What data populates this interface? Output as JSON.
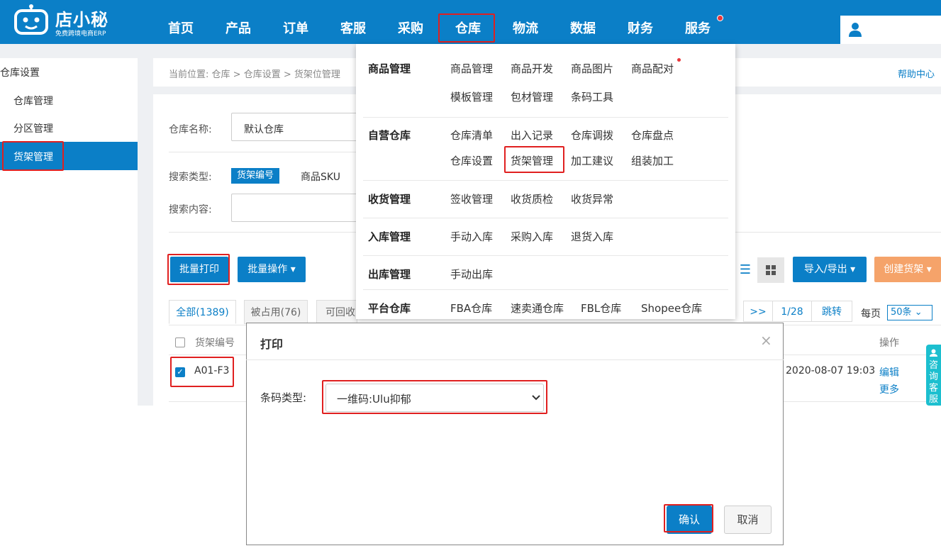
{
  "brand": {
    "name": "店小秘",
    "tagline": "免费跨境电商ERP"
  },
  "nav": {
    "items": [
      "首页",
      "产品",
      "订单",
      "客服",
      "采购",
      "仓库",
      "物流",
      "数据",
      "财务",
      "服务"
    ],
    "active": "仓库"
  },
  "sidebar": {
    "title": "仓库设置",
    "items": [
      "仓库管理",
      "分区管理",
      "货架管理"
    ],
    "active": "货架管理"
  },
  "breadcrumb": {
    "prefix": "当前位置:",
    "path": "仓库 > 仓库设置 > 货架位管理"
  },
  "help_label": "帮助中心",
  "filters": {
    "warehouse_label": "仓库名称:",
    "warehouse_value": "默认仓库",
    "search_type_label": "搜索类型:",
    "search_type_active": "货架编号",
    "search_type_other": "商品SKU",
    "search_content_label": "搜索内容:"
  },
  "actions": {
    "batch_print": "批量打印",
    "batch_ops": "批量操作",
    "import_export": "导入/导出",
    "create_shelf": "创建货架"
  },
  "tabs": [
    {
      "label": "全部(1389)"
    },
    {
      "label": "被占用(76)"
    },
    {
      "label": "可回收"
    }
  ],
  "pager": {
    "next": ">>",
    "page": "1/28",
    "jump": "跳转",
    "per_page_label": "每页",
    "per_page_value": "50条"
  },
  "table": {
    "col_code": "货架编号",
    "col_ops": "操作",
    "row": {
      "code": "A01-F3",
      "time": "2020-08-07 19:03",
      "edit": "编辑",
      "more": "更多"
    }
  },
  "consult_label": "咨询客服",
  "dropdown": {
    "sections": [
      {
        "name": "商品管理",
        "items": [
          "商品管理",
          "商品开发",
          "商品图片",
          "商品配对",
          "模板管理",
          "包材管理",
          "条码工具"
        ]
      },
      {
        "name": "自营仓库",
        "items": [
          "仓库清单",
          "出入记录",
          "仓库调拨",
          "仓库盘点",
          "仓库设置",
          "货架管理",
          "加工建议",
          "组装加工"
        ]
      },
      {
        "name": "收货管理",
        "items": [
          "签收管理",
          "收货质检",
          "收货异常"
        ]
      },
      {
        "name": "入库管理",
        "items": [
          "手动入库",
          "采购入库",
          "退货入库"
        ]
      },
      {
        "name": "出库管理",
        "items": [
          "手动出库"
        ]
      },
      {
        "name": "平台仓库",
        "items": [
          "FBA仓库",
          "速卖通仓库",
          "FBL仓库",
          "Shopee仓库"
        ]
      }
    ]
  },
  "modal": {
    "title": "打印",
    "close": "×",
    "barcode_label": "条码类型:",
    "barcode_value": "一维码:Ulu抑郁",
    "confirm": "确认",
    "cancel": "取消"
  },
  "colors": {
    "brand_blue": "#0b7fc7",
    "orange": "#f5a36a",
    "highlight_red": "#e02020",
    "consult_teal": "#1cbfcf"
  }
}
